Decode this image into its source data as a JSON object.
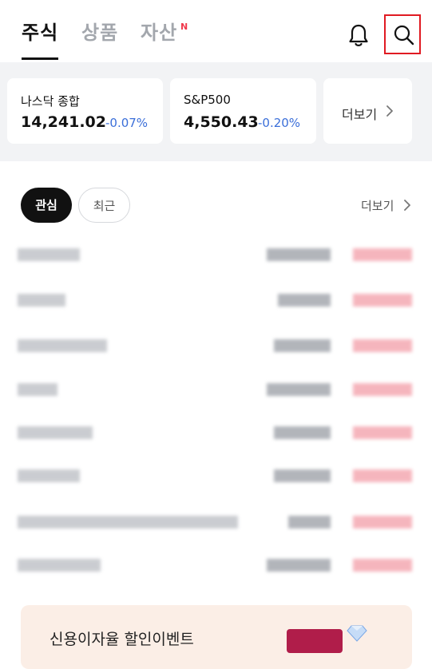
{
  "header": {
    "tabs": [
      {
        "label": "주식",
        "active": true
      },
      {
        "label": "상품",
        "active": false
      },
      {
        "label": "자산",
        "active": false
      }
    ],
    "asset_badge": "N",
    "icons": [
      "bell-icon",
      "search-icon"
    ]
  },
  "indices": [
    {
      "name": "나스닥 종합",
      "value": "14,241.02",
      "change": "-0.07%"
    },
    {
      "name": "S&P500",
      "value": "4,550.43",
      "change": "-0.20%"
    }
  ],
  "indices_more_label": "더보기",
  "watchlist": {
    "chips": [
      {
        "label": "관심",
        "active": true
      },
      {
        "label": "최근",
        "active": false
      }
    ],
    "more_label": "더보기",
    "rows_count_visible": 8
  },
  "banner": {
    "title": "신용이자율 할인이벤트"
  },
  "colors": {
    "accent_active": "#111111",
    "inactive_tab": "#a3a7ad",
    "negative_change": "#3b6fd9",
    "badge_red": "#f0394c",
    "highlight_box": "#e01a22",
    "banner_bg": "#fbeee6"
  }
}
